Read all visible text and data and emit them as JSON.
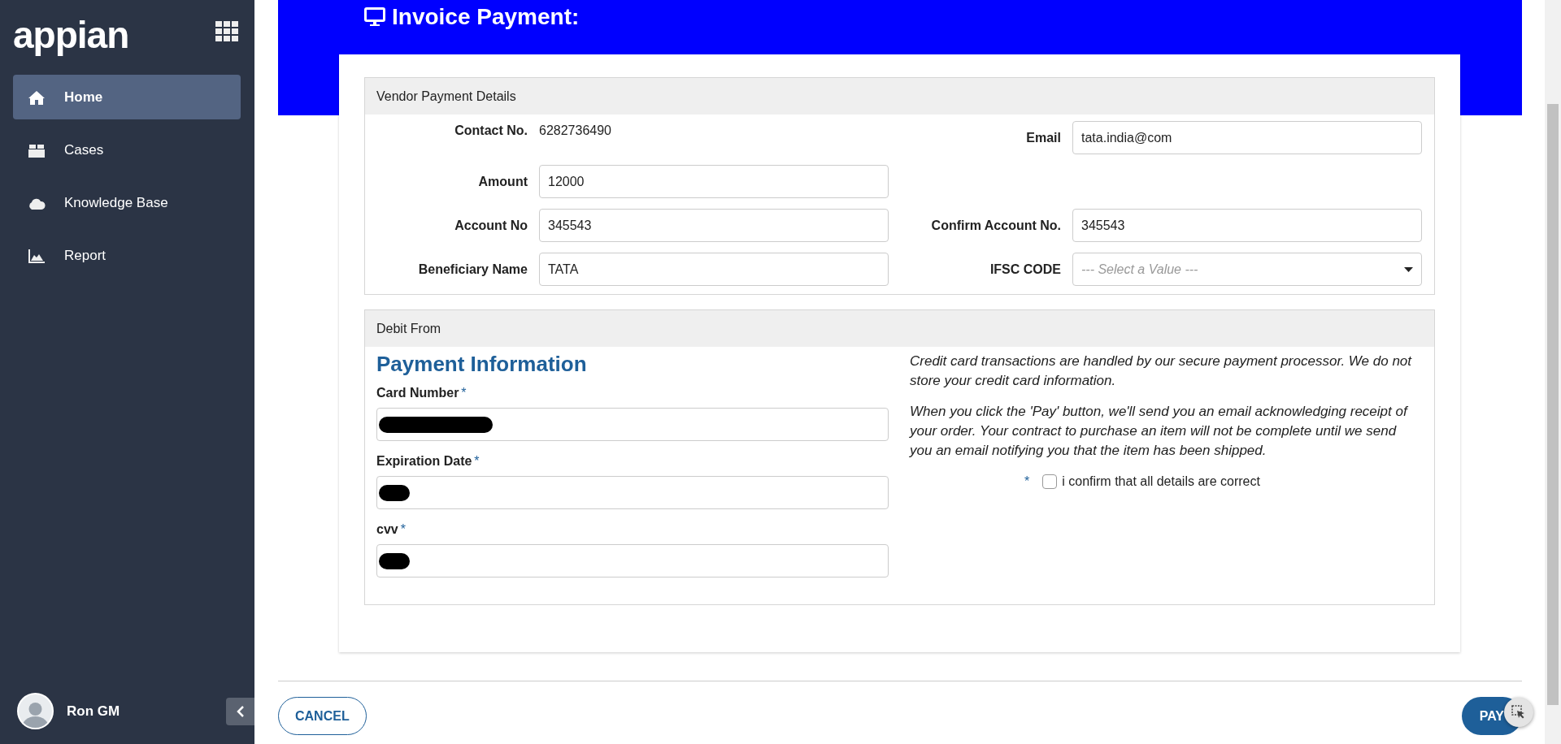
{
  "sidebar": {
    "logo": "appian",
    "items": [
      {
        "label": "Home",
        "selected": true
      },
      {
        "label": "Cases",
        "selected": false
      },
      {
        "label": "Knowledge Base",
        "selected": false
      },
      {
        "label": "Report",
        "selected": false
      }
    ],
    "user": {
      "name": "Ron GM"
    }
  },
  "page": {
    "title": "Invoice Payment:"
  },
  "vendor_section": {
    "title": "Vendor Payment Details",
    "rows": [
      [
        {
          "label": "Contact No.",
          "kind": "text",
          "value": "6282736490"
        },
        {
          "label": "Email",
          "kind": "input",
          "value": "tata.india@com"
        }
      ],
      [
        {
          "label": "Amount",
          "kind": "input",
          "value": "12000"
        }
      ],
      [
        {
          "label": "Account No",
          "kind": "input",
          "value": "345543"
        },
        {
          "label": "Confirm Account No.",
          "kind": "input",
          "value": "345543"
        }
      ],
      [
        {
          "label": "Beneficiary Name",
          "kind": "input",
          "value": "TATA"
        },
        {
          "label": "IFSC CODE",
          "kind": "select",
          "placeholder": "--- Select a Value ---"
        }
      ]
    ]
  },
  "debit_section": {
    "title": "Debit From",
    "heading": "Payment Information",
    "fields": [
      {
        "label": "Card Number",
        "required_mark": "*",
        "redacted": true
      },
      {
        "label": "Expiration Date",
        "required_mark": "*",
        "redacted": true
      },
      {
        "label": "cvv",
        "required_mark": "*",
        "redacted": true
      }
    ],
    "notes": [
      "Credit card transactions are handled by our secure payment processor. We do not store your credit card information.",
      "When you click the 'Pay' button, we'll send you an email acknowledging receipt of your order. Your contract to purchase an item will not be complete until we send you an email notifying you that the item has been shipped."
    ],
    "confirm": {
      "required_mark": "*",
      "label": "i confirm that all details are correct",
      "checked": false
    }
  },
  "footer": {
    "cancel": "CANCEL",
    "pay": "PAY"
  }
}
